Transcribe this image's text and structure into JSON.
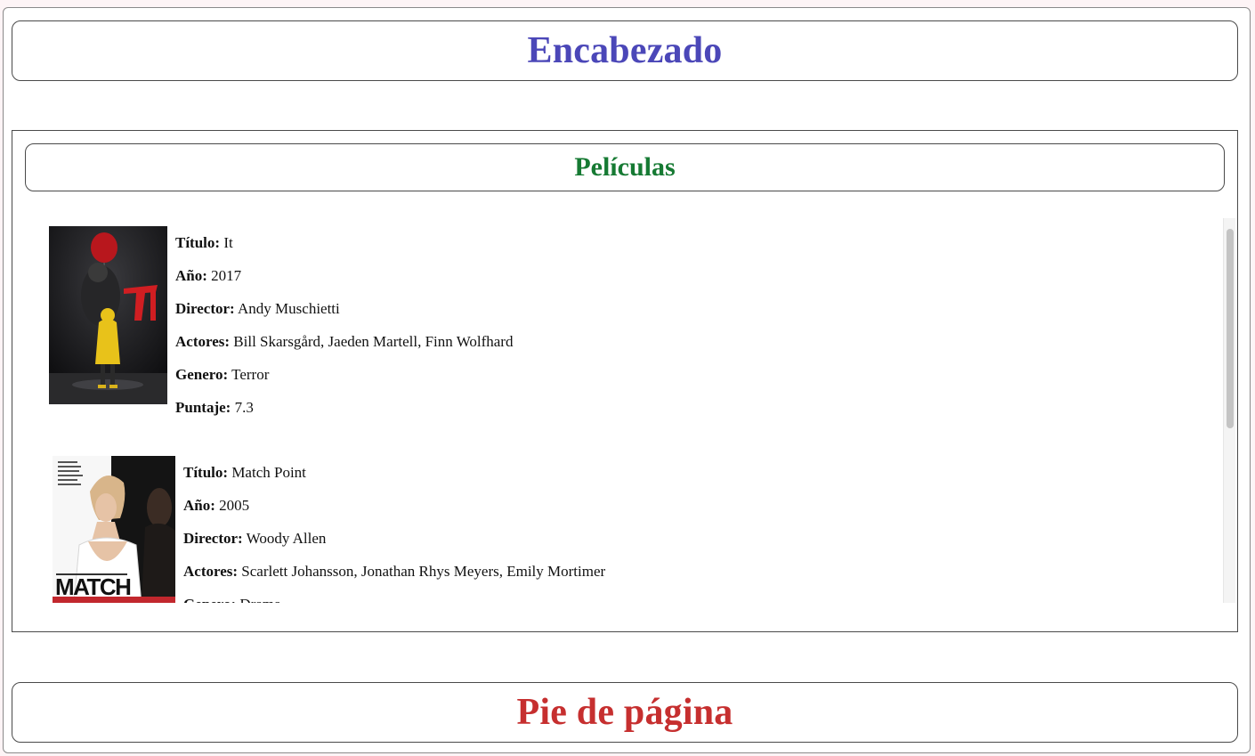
{
  "header": {
    "title": "Encabezado"
  },
  "section": {
    "title": "Películas"
  },
  "movies": [
    {
      "poster_icon": "it-movie-poster",
      "rows": [
        {
          "label": "Título:",
          "value": "It"
        },
        {
          "label": "Año:",
          "value": "2017"
        },
        {
          "label": "Director:",
          "value": "Andy Muschietti"
        },
        {
          "label": "Actores:",
          "value": "Bill Skarsgård, Jaeden Martell, Finn Wolfhard"
        },
        {
          "label": "Genero:",
          "value": "Terror"
        },
        {
          "label": "Puntaje:",
          "value": "7.3"
        }
      ]
    },
    {
      "poster_icon": "match-point-movie-poster",
      "poster_text": "MATCH",
      "rows": [
        {
          "label": "Título:",
          "value": "Match Point"
        },
        {
          "label": "Año:",
          "value": "2005"
        },
        {
          "label": "Director:",
          "value": "Woody Allen"
        },
        {
          "label": "Actores:",
          "value": "Scarlett Johansson, Jonathan Rhys Meyers, Emily Mortimer"
        },
        {
          "label": "Genero:",
          "value": "Drama"
        }
      ]
    }
  ],
  "footer": {
    "title": "Pie de página"
  },
  "colors": {
    "header_title": "#4b47b8",
    "section_title": "#167a33",
    "footer_title": "#c62f2f"
  }
}
